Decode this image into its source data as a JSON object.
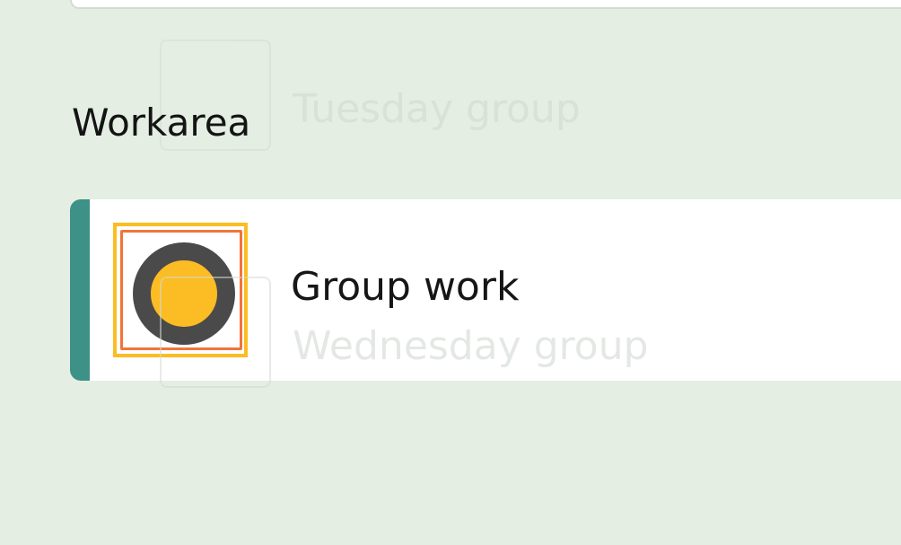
{
  "section": {
    "title": "Workarea"
  },
  "ghost_items": [
    {
      "label": "Tuesday group"
    },
    {
      "label": "Wednesday group"
    }
  ],
  "work_item": {
    "label": "Group work",
    "icon": "circle-status-icon",
    "accent_color": "#3d9187",
    "icon_fill": "#fbbd23",
    "icon_ring": "#4a4a4a"
  }
}
